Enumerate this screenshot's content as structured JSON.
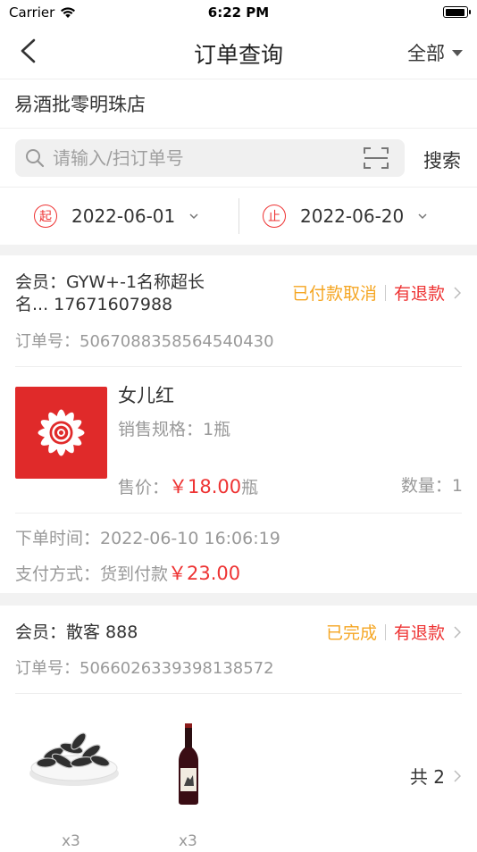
{
  "status_bar": {
    "carrier": "Carrier",
    "time": "6:22 PM"
  },
  "nav": {
    "title": "订单查询",
    "filter_label": "全部"
  },
  "store_name": "易酒批零明珠店",
  "search": {
    "placeholder": "请输入/扫订单号",
    "button_label": "搜索"
  },
  "dates": {
    "start_badge": "起",
    "start_value": "2022-06-01",
    "end_badge": "止",
    "end_value": "2022-06-20"
  },
  "orders": [
    {
      "member_label": "会员：",
      "member_line1": "GYW+-1名称超长",
      "member_line2": "名...  17671607988",
      "status": "已付款取消",
      "refund": "有退款",
      "order_no_label": "订单号：",
      "order_no": "5067088358564540430",
      "product": {
        "name": "女儿红",
        "spec_label": "销售规格：",
        "spec": "1瓶",
        "price_label": "售价：",
        "price": "￥18.00",
        "price_unit": "瓶",
        "qty_label": "数量：",
        "qty": "1"
      },
      "time_label": "下单时间：",
      "time": "2022-06-10 16:06:19",
      "pay_label": "支付方式：",
      "pay_method": "货到付款",
      "amount": "￥23.00"
    },
    {
      "member_label": "会员：",
      "member_line1": "散客  888",
      "status": "已完成",
      "refund": "有退款",
      "order_no_label": "订单号：",
      "order_no": "5066026339398138572",
      "items": [
        {
          "icon": "sunflower-seeds",
          "qty": "x3"
        },
        {
          "icon": "wine-bottle",
          "qty": "x3"
        }
      ],
      "total_label": "共 2"
    }
  ],
  "colors": {
    "accent_red": "#e33333",
    "status_orange": "#f5a623",
    "muted": "#999999"
  }
}
